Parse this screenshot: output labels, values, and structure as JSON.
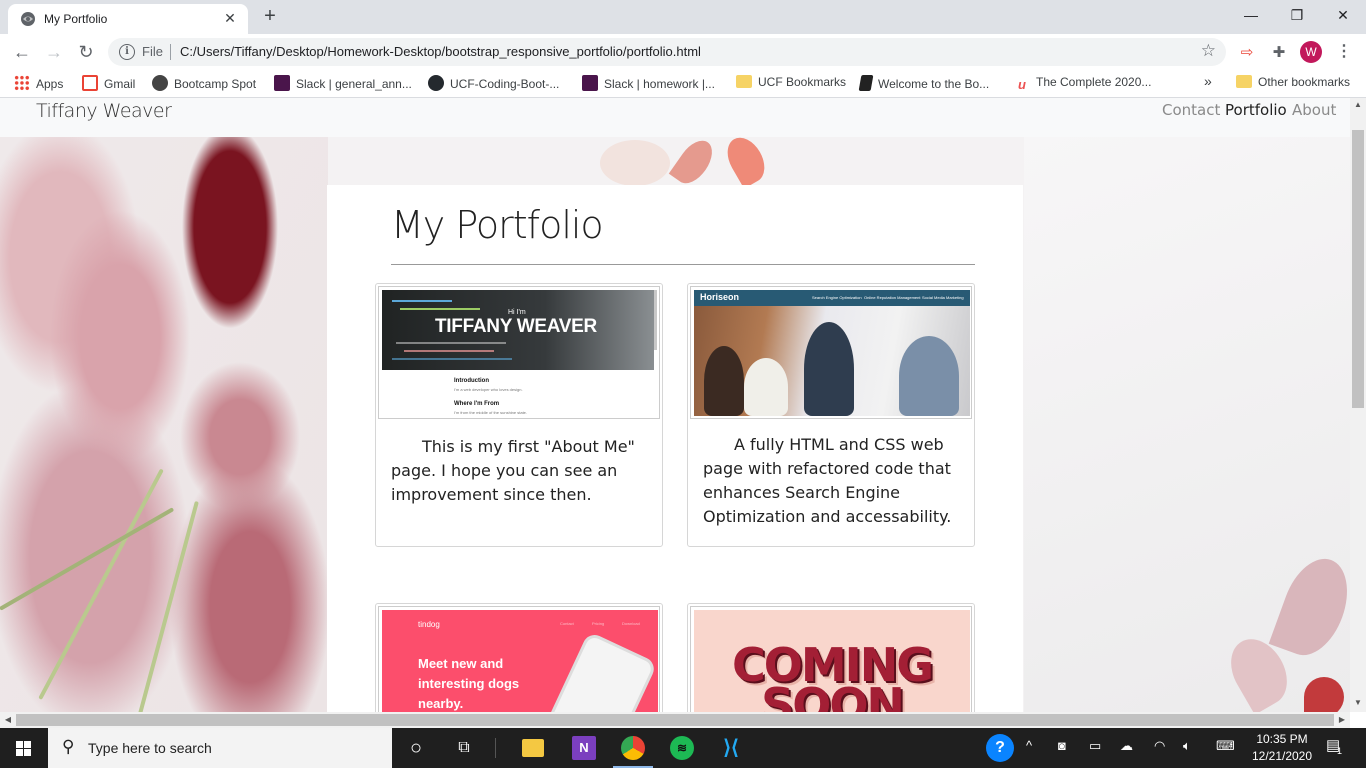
{
  "browser": {
    "tab_title": "My Portfolio",
    "new_tab_symbol": "+",
    "close_symbol": "✕",
    "window_buttons": {
      "minimize": "—",
      "restore": "❐",
      "close": "✕"
    },
    "omnibox": {
      "scheme_label": "File",
      "url": "C:/Users/Tiffany/Desktop/Homework-Desktop/bootstrap_responsive_portfolio/portfolio.html"
    },
    "profile_initial": "W",
    "bookmarks": [
      {
        "label": "Apps",
        "icon": "apps-grid-icon",
        "color": "#4285f4"
      },
      {
        "label": "Gmail",
        "icon": "gmail-icon",
        "color": "#ea4335"
      },
      {
        "label": "Bootcamp Spot",
        "icon": "bootcamp-icon",
        "color": "#444444"
      },
      {
        "label": "Slack | general_ann...",
        "icon": "slack-icon",
        "color": "#4a154b"
      },
      {
        "label": "UCF-Coding-Boot-...",
        "icon": "github-icon",
        "color": "#24292e"
      },
      {
        "label": "Slack | homework |...",
        "icon": "slack-icon",
        "color": "#4a154b"
      },
      {
        "label": "UCF Bookmarks",
        "icon": "folder-icon",
        "color": "#f6d365"
      },
      {
        "label": "Welcome to the Bo...",
        "icon": "book-icon",
        "color": "#222222"
      },
      {
        "label": "The Complete 2020...",
        "icon": "udemy-icon",
        "color": "#ec5252"
      }
    ],
    "bookmarks_overflow": "»",
    "other_bookmarks": "Other bookmarks"
  },
  "site": {
    "brand": "Tiffany Weaver",
    "nav": [
      {
        "label": "Contact",
        "active": false
      },
      {
        "label": "Portfolio",
        "active": true
      },
      {
        "label": "About",
        "active": false
      }
    ],
    "page_title": "My Portfolio",
    "projects": [
      {
        "description": "This is my first \"About Me\" page. I hope you can see an improvement since then.",
        "thumb": {
          "hi": "Hi I'm",
          "name": "TIFFANY WEAVER",
          "section1": "Introduction",
          "section1_text": "I'm a web developer who loves design.",
          "section2": "Where I'm From",
          "section2_text": "I'm from the middle of the sunshine state."
        }
      },
      {
        "description": "A fully HTML and CSS web page with refactored code that enhances Search Engine Optimization and accessability.",
        "thumb": {
          "logo": "Horiseon",
          "nav": [
            "Search Engine Optimization",
            "Online Reputation Management",
            "Social Media Marketing"
          ]
        }
      },
      {
        "description": "",
        "thumb": {
          "logo": "tindog",
          "nav": [
            "Contact",
            "Pricing",
            "Download"
          ],
          "headline": "Meet new and interesting dogs nearby."
        }
      },
      {
        "description": "",
        "thumb": {
          "line1": "COMING",
          "line2": "SOON"
        }
      }
    ]
  },
  "taskbar": {
    "search_placeholder": "Type here to search",
    "time": "10:35 PM",
    "date": "12/21/2020",
    "notification_count": "1",
    "help_symbol": "?"
  },
  "colors": {
    "nav_active": "#222222",
    "nav_inactive": "#8a8a8a",
    "accent_profile": "#c2185b"
  }
}
